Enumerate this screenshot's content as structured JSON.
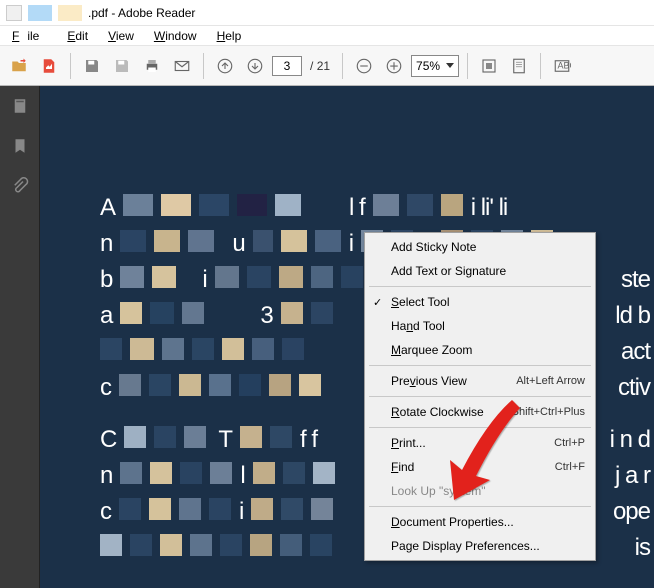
{
  "titlebar": {
    "filename": ".pdf",
    "app_name": "Adobe Reader"
  },
  "menubar": {
    "file": "File",
    "edit": "Edit",
    "view": "View",
    "window": "Window",
    "help": "Help"
  },
  "toolbar": {
    "page_current": "3",
    "page_sep": "/",
    "page_total": "21",
    "zoom_value": "75%"
  },
  "context_menu": {
    "add_sticky_note": "Add Sticky Note",
    "add_text_sig": "Add Text or Signature",
    "select_tool": "Select Tool",
    "hand_tool": "Hand Tool",
    "marquee_zoom": "Marquee Zoom",
    "previous_view": "Previous View",
    "previous_view_shortcut": "Alt+Left Arrow",
    "rotate_cw": "Rotate Clockwise",
    "rotate_cw_shortcut": "Shift+Ctrl+Plus",
    "print": "Print...",
    "print_shortcut": "Ctrl+P",
    "find": "Find",
    "find_shortcut": "Ctrl+F",
    "look_up": "Look Up \"system\"",
    "doc_properties": "Document Properties...",
    "page_display_prefs": "Page Display Preferences..."
  }
}
